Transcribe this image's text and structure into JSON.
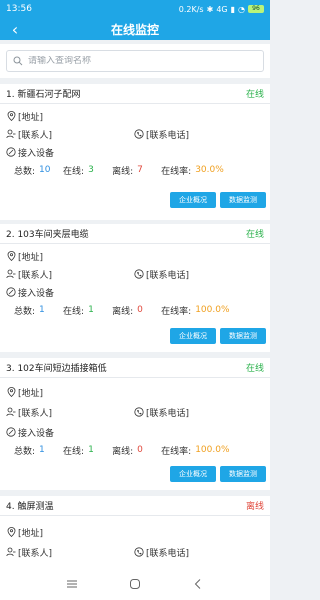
{
  "status": {
    "time": "13:56",
    "speed": "0.2K/s",
    "network": "4G",
    "battery": "96"
  },
  "header": {
    "title": "在线监控"
  },
  "search": {
    "placeholder": "请输入查询名称"
  },
  "cards": [
    {
      "title": "1. 新疆石河子配网",
      "status": "在线",
      "address": "[地址]",
      "contact": "[联系人]",
      "phone": "[联系电话]",
      "devices_label": "接入设备",
      "stats": {
        "total_label": "总数:",
        "total": "10",
        "online_label": "在线:",
        "online": "3",
        "offline_label": "离线:",
        "offline": "7",
        "rate_label": "在线率:",
        "rate": "30.0%"
      },
      "btn1": "企业概况",
      "btn2": "数据监测"
    },
    {
      "title": "2. 103车间夹层电缆",
      "status": "在线",
      "address": "[地址]",
      "contact": "[联系人]",
      "phone": "[联系电话]",
      "devices_label": "接入设备",
      "stats": {
        "total_label": "总数:",
        "total": "1",
        "online_label": "在线:",
        "online": "1",
        "offline_label": "离线:",
        "offline": "0",
        "rate_label": "在线率:",
        "rate": "100.0%"
      },
      "btn1": "企业概况",
      "btn2": "数据监测"
    },
    {
      "title": "3. 102车间短边插接箱低",
      "status": "在线",
      "address": "[地址]",
      "contact": "[联系人]",
      "phone": "[联系电话]",
      "devices_label": "接入设备",
      "stats": {
        "total_label": "总数:",
        "total": "1",
        "online_label": "在线:",
        "online": "1",
        "offline_label": "离线:",
        "offline": "0",
        "rate_label": "在线率:",
        "rate": "100.0%"
      },
      "btn1": "企业概况",
      "btn2": "数据监测"
    },
    {
      "title": "4. 触屏测温",
      "status": "离线",
      "address": "[地址]",
      "contact": "[联系人]",
      "phone": "[联系电话]"
    }
  ]
}
